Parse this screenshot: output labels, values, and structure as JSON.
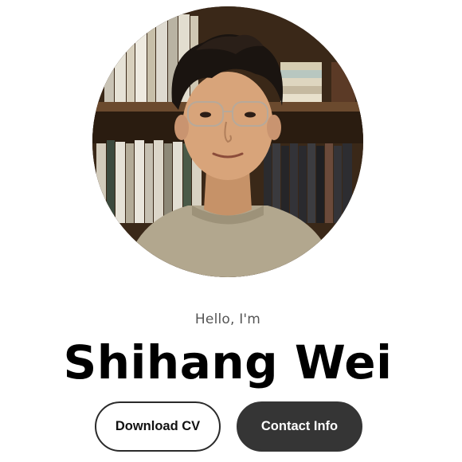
{
  "hero": {
    "greeting": "Hello, I'm",
    "name": "Shihang Wei",
    "avatar_alt": "Shihang Wei"
  },
  "actions": {
    "download_cv_label": "Download CV",
    "contact_info_label": "Contact Info"
  },
  "colors": {
    "primary_button_bg": "#353535",
    "outline_button_border": "#2a2a2a",
    "name_text": "#000000",
    "greeting_text": "#555555"
  }
}
